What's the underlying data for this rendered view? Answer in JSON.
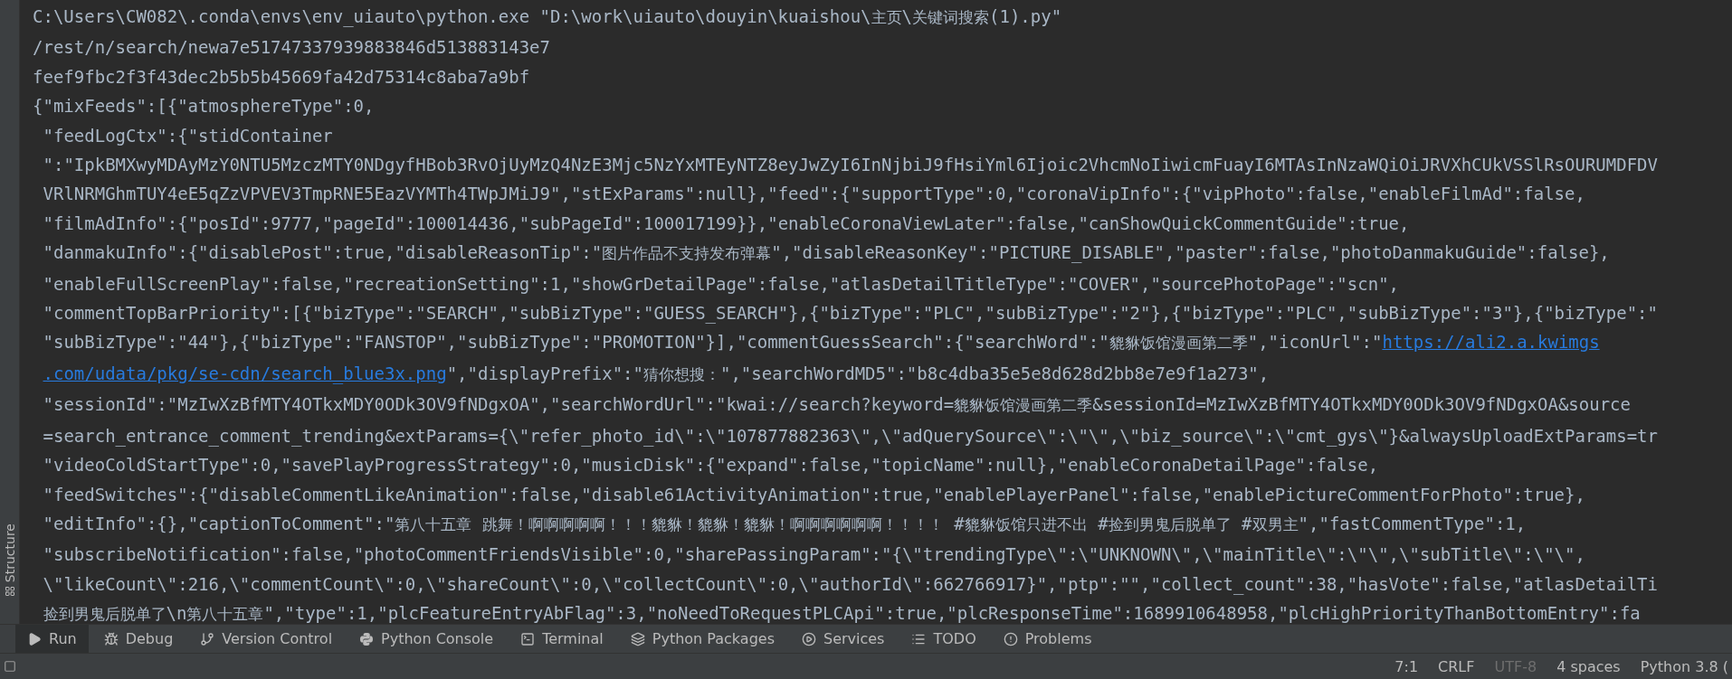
{
  "console": {
    "lines": [
      {
        "indented": false,
        "segments": [
          {
            "kind": "text",
            "text": "C:\\Users\\CW082\\.conda\\envs\\env_uiauto\\python.exe \"D:\\work\\uiauto\\douyin\\kuaishou\\主页\\关键词搜索(1).py\""
          }
        ]
      },
      {
        "indented": false,
        "segments": [
          {
            "kind": "text",
            "text": "/rest/n/search/newa7e51747337939883846d513883143e7"
          }
        ]
      },
      {
        "indented": false,
        "segments": [
          {
            "kind": "text",
            "text": "feef9fbc2f3f43dec2b5b5b45669fa42d75314c8aba7a9bf"
          }
        ]
      },
      {
        "indented": false,
        "segments": [
          {
            "kind": "text",
            "text": "{\"mixFeeds\":[{\"atmosphereType\":0,"
          }
        ]
      },
      {
        "indented": true,
        "segments": [
          {
            "kind": "text",
            "text": "\"feedLogCtx\":{\"stidContainer"
          }
        ]
      },
      {
        "indented": true,
        "segments": [
          {
            "kind": "text",
            "text": "\":\"IpkBMXwyMDAyMzY0NTU5MzczMTY0NDgyfHBob3RvOjUyMzQ4NzE3Mjc5NzYxMTEyNTZ8eyJwZyI6InNjbiJ9fHsiYml6Ijoic2VhcmNoIiwicmFuayI6MTAsInNzaWQiOiJRVXhCUkVSSlRsOURUMDFDV"
          }
        ]
      },
      {
        "indented": true,
        "segments": [
          {
            "kind": "text",
            "text": "VRlNRMGhmTUY4eE5qZzVPVEV3TmpRNE5EazVYMTh4TWpJMiJ9\",\"stExParams\":null},\"feed\":{\"supportType\":0,\"coronaVipInfo\":{\"vipPhoto\":false,\"enableFilmAd\":false,"
          }
        ]
      },
      {
        "indented": true,
        "segments": [
          {
            "kind": "text",
            "text": "\"filmAdInfo\":{\"posId\":9777,\"pageId\":100014436,\"subPageId\":100017199}},\"enableCoronaViewLater\":false,\"canShowQuickCommentGuide\":true,"
          }
        ]
      },
      {
        "indented": true,
        "segments": [
          {
            "kind": "text",
            "text": "\"danmakuInfo\":{\"disablePost\":true,\"disableReasonTip\":\"图片作品不支持发布弹幕\",\"disableReasonKey\":\"PICTURE_DISABLE\",\"paster\":false,\"photoDanmakuGuide\":false},"
          }
        ]
      },
      {
        "indented": true,
        "segments": [
          {
            "kind": "text",
            "text": "\"enableFullScreenPlay\":false,\"recreationSetting\":1,\"showGrDetailPage\":false,\"atlasDetailTitleType\":\"COVER\",\"sourcePhotoPage\":\"scn\","
          }
        ]
      },
      {
        "indented": true,
        "segments": [
          {
            "kind": "text",
            "text": "\"commentTopBarPriority\":[{\"bizType\":\"SEARCH\",\"subBizType\":\"GUESS_SEARCH\"},{\"bizType\":\"PLC\",\"subBizType\":\"2\"},{\"bizType\":\"PLC\",\"subBizType\":\"3\"},{\"bizType\":\""
          }
        ]
      },
      {
        "indented": true,
        "segments": [
          {
            "kind": "text",
            "text": "\"subBizType\":\"44\"},{\"bizType\":\"FANSTOP\",\"subBizType\":\"PROMOTION\"}],\"commentGuessSearch\":{\"searchWord\":\"貔貅饭馆漫画第二季\",\"iconUrl\":\""
          },
          {
            "kind": "link",
            "text": "https://ali2.a.kwimgs"
          }
        ]
      },
      {
        "indented": true,
        "segments": [
          {
            "kind": "link",
            "text": ".com/udata/pkg/se-cdn/search_blue3x.png"
          },
          {
            "kind": "text",
            "text": "\",\"displayPrefix\":\"猜你想搜：\",\"searchWordMD5\":\"b8c4dba35e5e8d628d2bb8e7e9f1a273\","
          }
        ]
      },
      {
        "indented": true,
        "segments": [
          {
            "kind": "text",
            "text": "\"sessionId\":\"MzIwXzBfMTY4OTkxMDY0ODk3OV9fNDgxOA\",\"searchWordUrl\":\"kwai://search?keyword=貔貅饭馆漫画第二季&sessionId=MzIwXzBfMTY4OTkxMDY0ODk3OV9fNDgxOA&source"
          }
        ]
      },
      {
        "indented": true,
        "segments": [
          {
            "kind": "text",
            "text": "=search_entrance_comment_trending&extParams={\\\"refer_photo_id\\\":\\\"107877882363\\\",\\\"adQuerySource\\\":\\\"\\\",\\\"biz_source\\\":\\\"cmt_gys\\\"}&alwaysUploadExtParams=tr"
          }
        ]
      },
      {
        "indented": true,
        "segments": [
          {
            "kind": "text",
            "text": "\"videoColdStartType\":0,\"savePlayProgressStrategy\":0,\"musicDisk\":{\"expand\":false,\"topicName\":null},\"enableCoronaDetailPage\":false,"
          }
        ]
      },
      {
        "indented": true,
        "segments": [
          {
            "kind": "text",
            "text": "\"feedSwitches\":{\"disableCommentLikeAnimation\":false,\"disable61ActivityAnimation\":true,\"enablePlayerPanel\":false,\"enablePictureCommentForPhoto\":true},"
          }
        ]
      },
      {
        "indented": true,
        "segments": [
          {
            "kind": "text",
            "text": "\"editInfo\":{},\"captionToComment\":\"第八十五章 跳舞！啊啊啊啊啊！！！貔貅！貔貅！貔貅！啊啊啊啊啊啊！！！！ #貔貅饭馆只进不出 #捡到男鬼后脱单了 #双男主\",\"fastCommentType\":1,"
          }
        ]
      },
      {
        "indented": true,
        "segments": [
          {
            "kind": "text",
            "text": "\"subscribeNotification\":false,\"photoCommentFriendsVisible\":0,\"sharePassingParam\":\"{\\\"trendingType\\\":\\\"UNKNOWN\\\",\\\"mainTitle\\\":\\\"\\\",\\\"subTitle\\\":\\\"\\\","
          }
        ]
      },
      {
        "indented": true,
        "segments": [
          {
            "kind": "text",
            "text": "\\\"likeCount\\\":216,\\\"commentCount\\\":0,\\\"shareCount\\\":0,\\\"collectCount\\\":0,\\\"authorId\\\":662766917}\",\"ptp\":\"\",\"collect_count\":38,\"hasVote\":false,\"atlasDetailTi"
          }
        ]
      },
      {
        "indented": true,
        "segments": [
          {
            "kind": "text",
            "text": "捡到男鬼后脱单了\\n第八十五章\",\"type\":1,\"plcFeatureEntryAbFlag\":3,\"noNeedToRequestPLCApi\":true,\"plcResponseTime\":1689910648958,\"plcHighPriorityThanBottomEntry\":fa"
          }
        ]
      }
    ]
  },
  "sidebar": {
    "label": "Structure"
  },
  "tool_tabs": [
    {
      "label": "Run",
      "selected": true
    },
    {
      "label": "Debug",
      "selected": false
    },
    {
      "label": "Version Control",
      "selected": false
    },
    {
      "label": "Python Console",
      "selected": false
    },
    {
      "label": "Terminal",
      "selected": false
    },
    {
      "label": "Python Packages",
      "selected": false
    },
    {
      "label": "Services",
      "selected": false
    },
    {
      "label": "TODO",
      "selected": false
    },
    {
      "label": "Problems",
      "selected": false
    }
  ],
  "status_bar": {
    "items": [
      {
        "text": "7:1",
        "disabled": false
      },
      {
        "text": "CRLF",
        "disabled": false
      },
      {
        "text": "UTF-8",
        "disabled": true
      },
      {
        "text": "4 spaces",
        "disabled": false
      },
      {
        "text": "Python 3.8 (",
        "disabled": false
      }
    ]
  }
}
